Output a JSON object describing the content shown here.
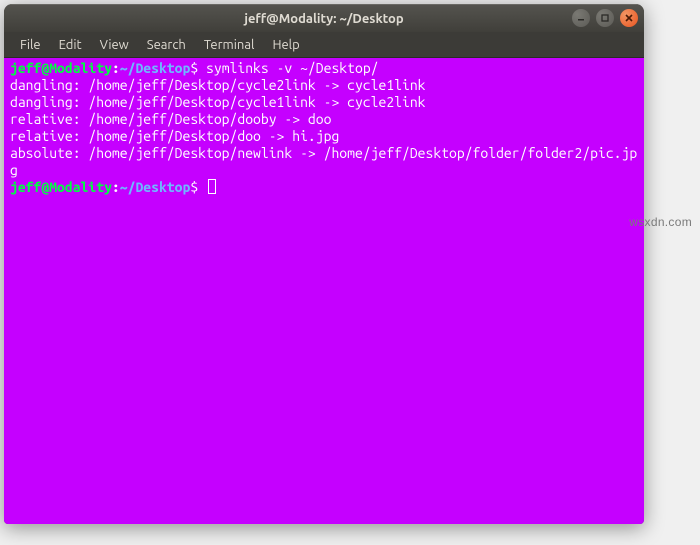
{
  "window": {
    "title": "jeff@Modality: ~/Desktop"
  },
  "menubar": {
    "items": [
      "File",
      "Edit",
      "View",
      "Search",
      "Terminal",
      "Help"
    ]
  },
  "prompt1": {
    "user_host": "jeff@Modality",
    "colon": ":",
    "path": "~/Desktop",
    "dollar": "$ ",
    "command": "symlinks -v ~/Desktop/"
  },
  "output": {
    "l1": "dangling: /home/jeff/Desktop/cycle2link -> cycle1link",
    "l2": "dangling: /home/jeff/Desktop/cycle1link -> cycle2link",
    "l3": "relative: /home/jeff/Desktop/dooby -> doo",
    "l4": "relative: /home/jeff/Desktop/doo -> hi.jpg",
    "l5": "absolute: /home/jeff/Desktop/newlink -> /home/jeff/Desktop/folder/folder2/pic.jpg"
  },
  "prompt2": {
    "user_host": "jeff@Modality",
    "colon": ":",
    "path": "~/Desktop",
    "dollar": "$ "
  },
  "watermark": "wsxdn.com"
}
